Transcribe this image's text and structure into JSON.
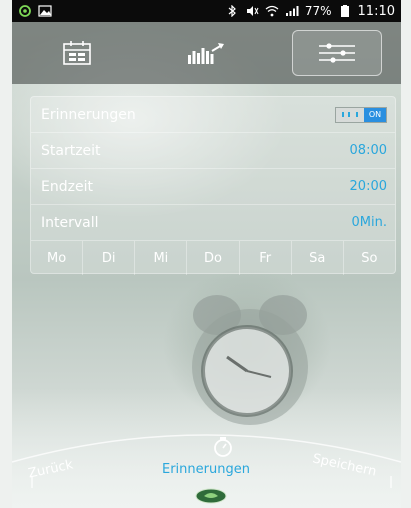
{
  "status_bar": {
    "battery_percent": "77%",
    "time": "11:10"
  },
  "top_nav": {
    "tabs": [
      {
        "name": "calendar-icon"
      },
      {
        "name": "chart-icon"
      },
      {
        "name": "settings-sliders-icon",
        "active": true
      }
    ]
  },
  "settings": {
    "reminder_label": "Erinnerungen",
    "toggle_on_label": "ON",
    "start_label": "Startzeit",
    "start_value": "08:00",
    "end_label": "Endzeit",
    "end_value": "20:00",
    "interval_label": "Intervall",
    "interval_value": "0Min."
  },
  "days": [
    "Mo",
    "Di",
    "Mi",
    "Do",
    "Fr",
    "Sa",
    "So"
  ],
  "bottom_nav": {
    "back_label": "Zurück",
    "center_label": "Erinnerungen",
    "save_label": "Speichern"
  },
  "colors": {
    "accent": "#2aa7dc",
    "toggle_on": "#2a8fe0"
  }
}
